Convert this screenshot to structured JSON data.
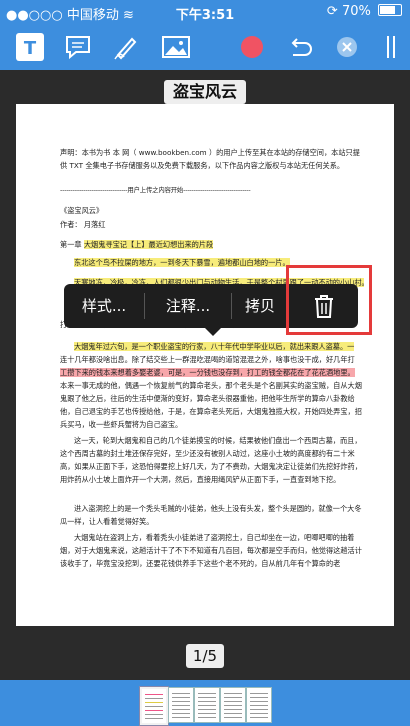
{
  "status": {
    "carrier": "●●○○○ 中国移动",
    "wifi": "≋",
    "time": "下午3:51",
    "battery": "70%"
  },
  "toolbar": {
    "colors": {
      "bar": "#3d8ede",
      "record": "#f05363"
    }
  },
  "document": {
    "title": "盗宝风云"
  },
  "page_text": {
    "p1": "声明：本书为书 本 网（ www.bookben.com ）的用户上传至其在本站的存储空间，本站只提供 TXT 全集电子书存储服务以及免费下载服务，以下作品内容之版权与本站无任何关系。",
    "upload_line": "--------------------------------用户上传之内容开始--------------------------------",
    "book_title": "《盗宝风云》",
    "author": "作者： 月落红",
    "chapter_prefix": "第一章 ",
    "chapter_hl": "大烟鬼寻宝记【上】最近幻想出来的片段",
    "line1": "东北这个鸟不拉屎的地方，一到冬天下暴雪，遍地都山白地的一片。",
    "line2": "天寒地冻，冷极，冷冻，人们都很少出门与动物生活，于是整个村里跟了一动不动的小山村。",
    "line3": "打了几个暗色，五个老家伙扛着铁镐往阴处后的小山坡走去。",
    "para2_hl": "大烟鬼年过六旬，是一个职业盗宝的行家，八十年代中学毕业以后，就出来跟人盗墓。一",
    "para2_b": "连十几年都没啥出息。除了结交些上一群混吃混喝的道馆混混之外，啥事也没干成，好几年打",
    "para2_hl2": "工攒下来的钱本来想着多娶老婆，可是，一分钱也没存到，打工的钱全都花在了花花酒地里。",
    "para2_c": "本来一事无成的他，偶遇一个恢复前气的算命老头，那个老头是个名副其实的盗宝贼，自从大烟鬼跟了他之后，往后的生活中便渐的变好，算命老头很器重他，把他毕生所学的算命八卦教给他，自己退宝的手艺也传授给他，于是，在算命老头死后，大烟鬼独揽大权，开始四处弄宝，招兵买马，收一些虾兵蟹将为自己盗宝。",
    "para3": "这一天，轮到大烟鬼和自己的几个徒弟摸宝的时候，结果被他们盘出一个西周古墓，而且，这个西周古墓的封土堆还保存完好，至少还没有被别人动过，这座小土坡的高度都约有二十米高，如果从正面下手，这恐怕得要挖上好几天，为了不费劲，大烟鬼决定让徒弟们先挖好炸药，用炸药从小土坡上面炸开一个大洞，然后，直接用绳风铲从正面下手，一直查到地下挖。",
    "para4": "进入盗洞挖上的是一个秃头毛贼的小徒弟，他头上没有头发，整个头是圆的，就像一个大冬瓜一样，让人看着觉得好笑。",
    "para5": "大烟鬼站在盗洞上方，看着秃头小徒弟进了盗洞挖土，自己却坐在一边，吧唧吧唧的抽着烟，对于大烟鬼来说，这趟活计干了不下不知道有几百回，每次都是空手而归，他觉得这趟活计该收手了，毕竟宝没挖到，还要花钱供养手下这些个老不死的，自从前几年有个算命的老"
  },
  "context_menu": {
    "style": "样式...",
    "annotate": "注释...",
    "copy": "拷贝"
  },
  "pagination": {
    "current": "1/5"
  }
}
